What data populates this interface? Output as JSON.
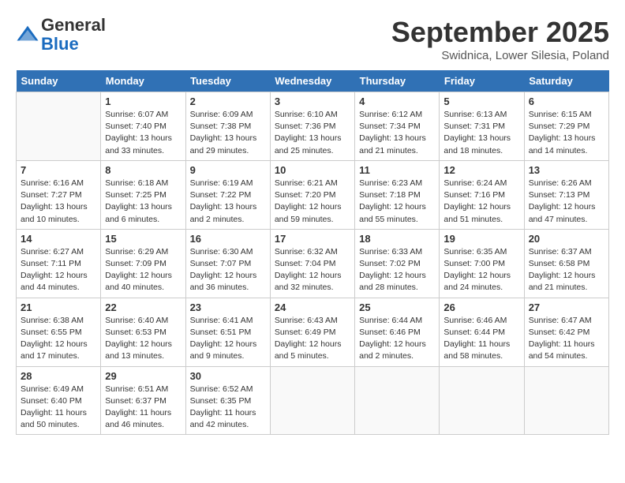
{
  "header": {
    "logo_general": "General",
    "logo_blue": "Blue",
    "month_title": "September 2025",
    "location": "Swidnica, Lower Silesia, Poland"
  },
  "weekdays": [
    "Sunday",
    "Monday",
    "Tuesday",
    "Wednesday",
    "Thursday",
    "Friday",
    "Saturday"
  ],
  "weeks": [
    [
      {
        "day": "",
        "info": ""
      },
      {
        "day": "1",
        "info": "Sunrise: 6:07 AM\nSunset: 7:40 PM\nDaylight: 13 hours\nand 33 minutes."
      },
      {
        "day": "2",
        "info": "Sunrise: 6:09 AM\nSunset: 7:38 PM\nDaylight: 13 hours\nand 29 minutes."
      },
      {
        "day": "3",
        "info": "Sunrise: 6:10 AM\nSunset: 7:36 PM\nDaylight: 13 hours\nand 25 minutes."
      },
      {
        "day": "4",
        "info": "Sunrise: 6:12 AM\nSunset: 7:34 PM\nDaylight: 13 hours\nand 21 minutes."
      },
      {
        "day": "5",
        "info": "Sunrise: 6:13 AM\nSunset: 7:31 PM\nDaylight: 13 hours\nand 18 minutes."
      },
      {
        "day": "6",
        "info": "Sunrise: 6:15 AM\nSunset: 7:29 PM\nDaylight: 13 hours\nand 14 minutes."
      }
    ],
    [
      {
        "day": "7",
        "info": "Sunrise: 6:16 AM\nSunset: 7:27 PM\nDaylight: 13 hours\nand 10 minutes."
      },
      {
        "day": "8",
        "info": "Sunrise: 6:18 AM\nSunset: 7:25 PM\nDaylight: 13 hours\nand 6 minutes."
      },
      {
        "day": "9",
        "info": "Sunrise: 6:19 AM\nSunset: 7:22 PM\nDaylight: 13 hours\nand 2 minutes."
      },
      {
        "day": "10",
        "info": "Sunrise: 6:21 AM\nSunset: 7:20 PM\nDaylight: 12 hours\nand 59 minutes."
      },
      {
        "day": "11",
        "info": "Sunrise: 6:23 AM\nSunset: 7:18 PM\nDaylight: 12 hours\nand 55 minutes."
      },
      {
        "day": "12",
        "info": "Sunrise: 6:24 AM\nSunset: 7:16 PM\nDaylight: 12 hours\nand 51 minutes."
      },
      {
        "day": "13",
        "info": "Sunrise: 6:26 AM\nSunset: 7:13 PM\nDaylight: 12 hours\nand 47 minutes."
      }
    ],
    [
      {
        "day": "14",
        "info": "Sunrise: 6:27 AM\nSunset: 7:11 PM\nDaylight: 12 hours\nand 44 minutes."
      },
      {
        "day": "15",
        "info": "Sunrise: 6:29 AM\nSunset: 7:09 PM\nDaylight: 12 hours\nand 40 minutes."
      },
      {
        "day": "16",
        "info": "Sunrise: 6:30 AM\nSunset: 7:07 PM\nDaylight: 12 hours\nand 36 minutes."
      },
      {
        "day": "17",
        "info": "Sunrise: 6:32 AM\nSunset: 7:04 PM\nDaylight: 12 hours\nand 32 minutes."
      },
      {
        "day": "18",
        "info": "Sunrise: 6:33 AM\nSunset: 7:02 PM\nDaylight: 12 hours\nand 28 minutes."
      },
      {
        "day": "19",
        "info": "Sunrise: 6:35 AM\nSunset: 7:00 PM\nDaylight: 12 hours\nand 24 minutes."
      },
      {
        "day": "20",
        "info": "Sunrise: 6:37 AM\nSunset: 6:58 PM\nDaylight: 12 hours\nand 21 minutes."
      }
    ],
    [
      {
        "day": "21",
        "info": "Sunrise: 6:38 AM\nSunset: 6:55 PM\nDaylight: 12 hours\nand 17 minutes."
      },
      {
        "day": "22",
        "info": "Sunrise: 6:40 AM\nSunset: 6:53 PM\nDaylight: 12 hours\nand 13 minutes."
      },
      {
        "day": "23",
        "info": "Sunrise: 6:41 AM\nSunset: 6:51 PM\nDaylight: 12 hours\nand 9 minutes."
      },
      {
        "day": "24",
        "info": "Sunrise: 6:43 AM\nSunset: 6:49 PM\nDaylight: 12 hours\nand 5 minutes."
      },
      {
        "day": "25",
        "info": "Sunrise: 6:44 AM\nSunset: 6:46 PM\nDaylight: 12 hours\nand 2 minutes."
      },
      {
        "day": "26",
        "info": "Sunrise: 6:46 AM\nSunset: 6:44 PM\nDaylight: 11 hours\nand 58 minutes."
      },
      {
        "day": "27",
        "info": "Sunrise: 6:47 AM\nSunset: 6:42 PM\nDaylight: 11 hours\nand 54 minutes."
      }
    ],
    [
      {
        "day": "28",
        "info": "Sunrise: 6:49 AM\nSunset: 6:40 PM\nDaylight: 11 hours\nand 50 minutes."
      },
      {
        "day": "29",
        "info": "Sunrise: 6:51 AM\nSunset: 6:37 PM\nDaylight: 11 hours\nand 46 minutes."
      },
      {
        "day": "30",
        "info": "Sunrise: 6:52 AM\nSunset: 6:35 PM\nDaylight: 11 hours\nand 42 minutes."
      },
      {
        "day": "",
        "info": ""
      },
      {
        "day": "",
        "info": ""
      },
      {
        "day": "",
        "info": ""
      },
      {
        "day": "",
        "info": ""
      }
    ]
  ]
}
